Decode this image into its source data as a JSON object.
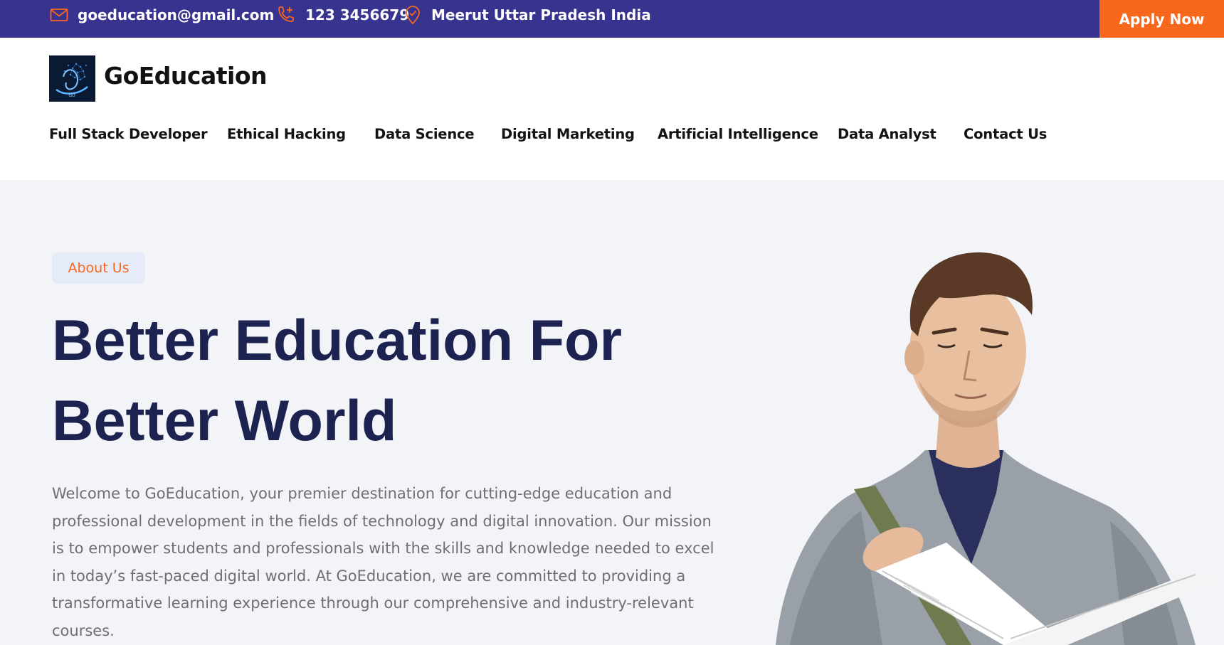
{
  "topbar": {
    "email": "goeducation@gmail.com",
    "phone": "123 3456679",
    "location": "Meerut Uttar Pradesh India",
    "apply_label": "Apply Now",
    "colors": {
      "background": "#38338f",
      "accent": "#f7681c",
      "icon": "#f7681c"
    },
    "icons": {
      "email": "mail-icon",
      "phone": "phone-plus-icon",
      "location": "location-pin-icon"
    }
  },
  "header": {
    "brand": "GoEducation",
    "logo_icon": "brain-head-logo",
    "nav": [
      {
        "label": "Full Stack Developer"
      },
      {
        "label": "Ethical Hacking"
      },
      {
        "label": "Data Science"
      },
      {
        "label": "Digital Marketing"
      },
      {
        "label": "Artificial Intelligence"
      },
      {
        "label": "Data Analyst"
      },
      {
        "label": "Contact Us"
      }
    ]
  },
  "hero": {
    "badge": "About Us",
    "headline_line1": "Better Education For",
    "headline_line2": "Better World",
    "intro": "Welcome to GoEducation, your premier destination for cutting-edge education and professional development in the fields of technology and digital innovation. Our mission is to empower students and professionals with the skills and knowledge needed to excel in today’s fast-paced digital world. At GoEducation, we are committed to providing a transformative learning experience through our comprehensive and industry-relevant courses.",
    "image_icon": "student-reading-book-illustration",
    "colors": {
      "background": "#f3f4f8",
      "headline": "#1d2350",
      "badge_bg": "#e6ebfa",
      "badge_text": "#f7681c"
    }
  }
}
